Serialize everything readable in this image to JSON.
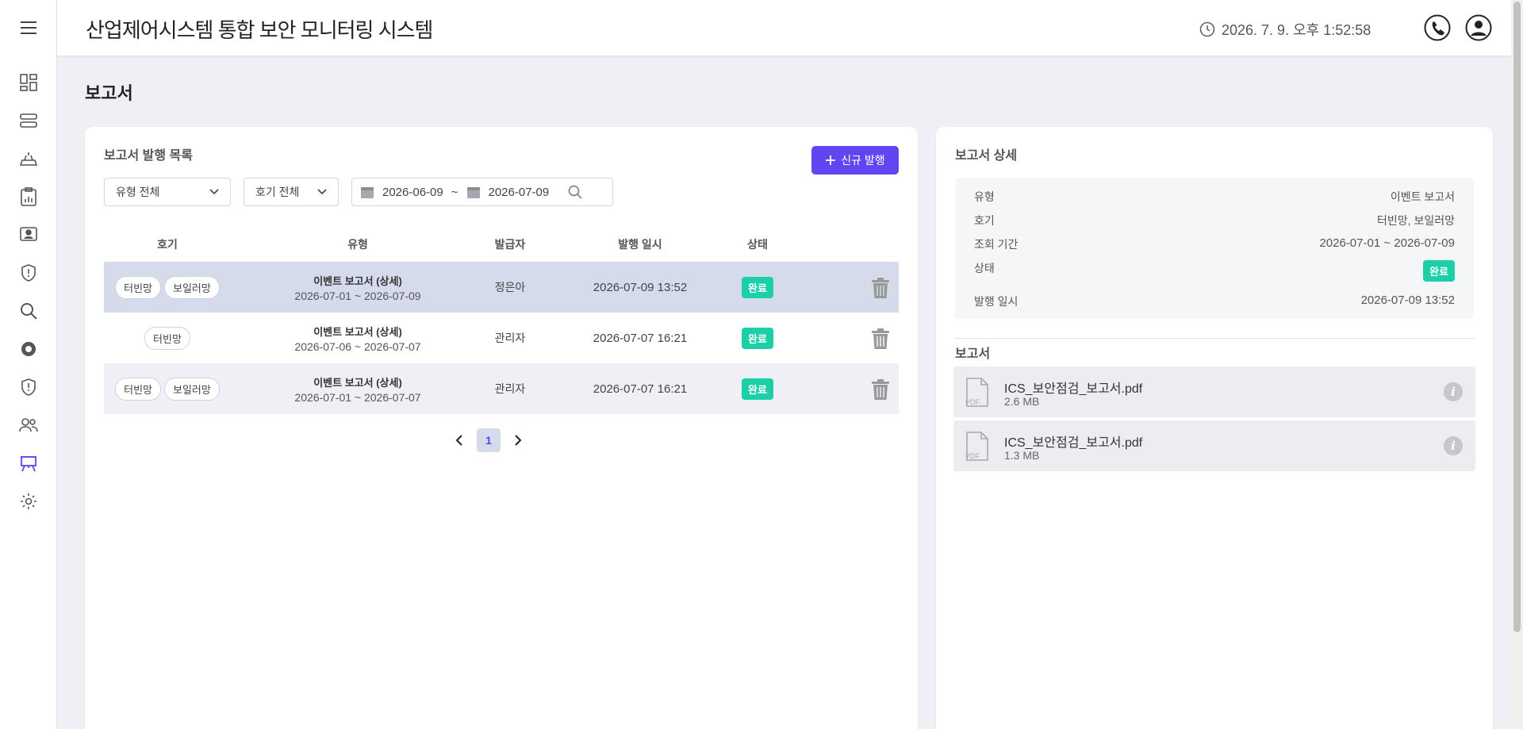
{
  "header": {
    "title": "산업제어시스템 통합 보안 모니터링 시스템",
    "datetime": "2026. 7. 9. 오후 1:52:58"
  },
  "sidebar": {
    "items": [
      {
        "icon": "dashboard-icon"
      },
      {
        "icon": "server-icon"
      },
      {
        "icon": "router-icon"
      },
      {
        "icon": "clipboard-chart-icon"
      },
      {
        "icon": "monitor-user-icon"
      },
      {
        "icon": "shield-alert-icon"
      },
      {
        "icon": "search-icon"
      },
      {
        "icon": "gear-shield-icon"
      },
      {
        "icon": "shield-exclamation-icon"
      },
      {
        "icon": "users-icon"
      },
      {
        "icon": "report-board-icon",
        "active": true
      },
      {
        "icon": "settings-icon"
      }
    ]
  },
  "page": {
    "title": "보고서"
  },
  "report_list": {
    "title": "보고서 발행 목록",
    "new_button": "신규 발행",
    "filters": {
      "type": "유형 전체",
      "line": "호기 전체",
      "date_from": "2026-06-09",
      "date_sep": "~",
      "date_to": "2026-07-09"
    },
    "columns": [
      "호기",
      "유형",
      "발급자",
      "발행 일시",
      "상태"
    ],
    "rows": [
      {
        "tags": [
          "터빈망",
          "보일러망"
        ],
        "type": "이벤트 보고서 (상세)",
        "range": "2026-07-01 ~ 2026-07-09",
        "issuer": "정은아",
        "issued_at": "2026-07-09 13:52",
        "status": "완료"
      },
      {
        "tags": [
          "터빈망"
        ],
        "type": "이벤트 보고서 (상세)",
        "range": "2026-07-06 ~ 2026-07-07",
        "issuer": "관리자",
        "issued_at": "2026-07-07 16:21",
        "status": "완료"
      },
      {
        "tags": [
          "터빈망",
          "보일러망"
        ],
        "type": "이벤트 보고서 (상세)",
        "range": "2026-07-01 ~ 2026-07-07",
        "issuer": "관리자",
        "issued_at": "2026-07-07 16:21",
        "status": "완료"
      }
    ],
    "pagination": {
      "current": "1"
    }
  },
  "report_detail": {
    "title": "보고서 상세",
    "fields": {
      "type_label": "유형",
      "type_value": "이벤트 보고서",
      "line_label": "호기",
      "line_value": "터빈망, 보일러망",
      "period_label": "조회 기간",
      "period_value": "2026-07-01 ~ 2026-07-09",
      "status_label": "상태",
      "status_value": "완료",
      "issued_label": "발행 일시",
      "issued_value": "2026-07-09 13:52"
    },
    "files_title": "보고서",
    "files": [
      {
        "name": "ICS_보안점검_보고서.pdf",
        "size": "2.6 MB",
        "icon_text": "PDF"
      },
      {
        "name": "ICS_보안점검_보고서.pdf",
        "size": "1.3 MB",
        "icon_text": "PDF"
      }
    ]
  },
  "colors": {
    "accent": "#6046f0",
    "success": "#1ccfa8",
    "selected_row": "#d6dbec"
  }
}
